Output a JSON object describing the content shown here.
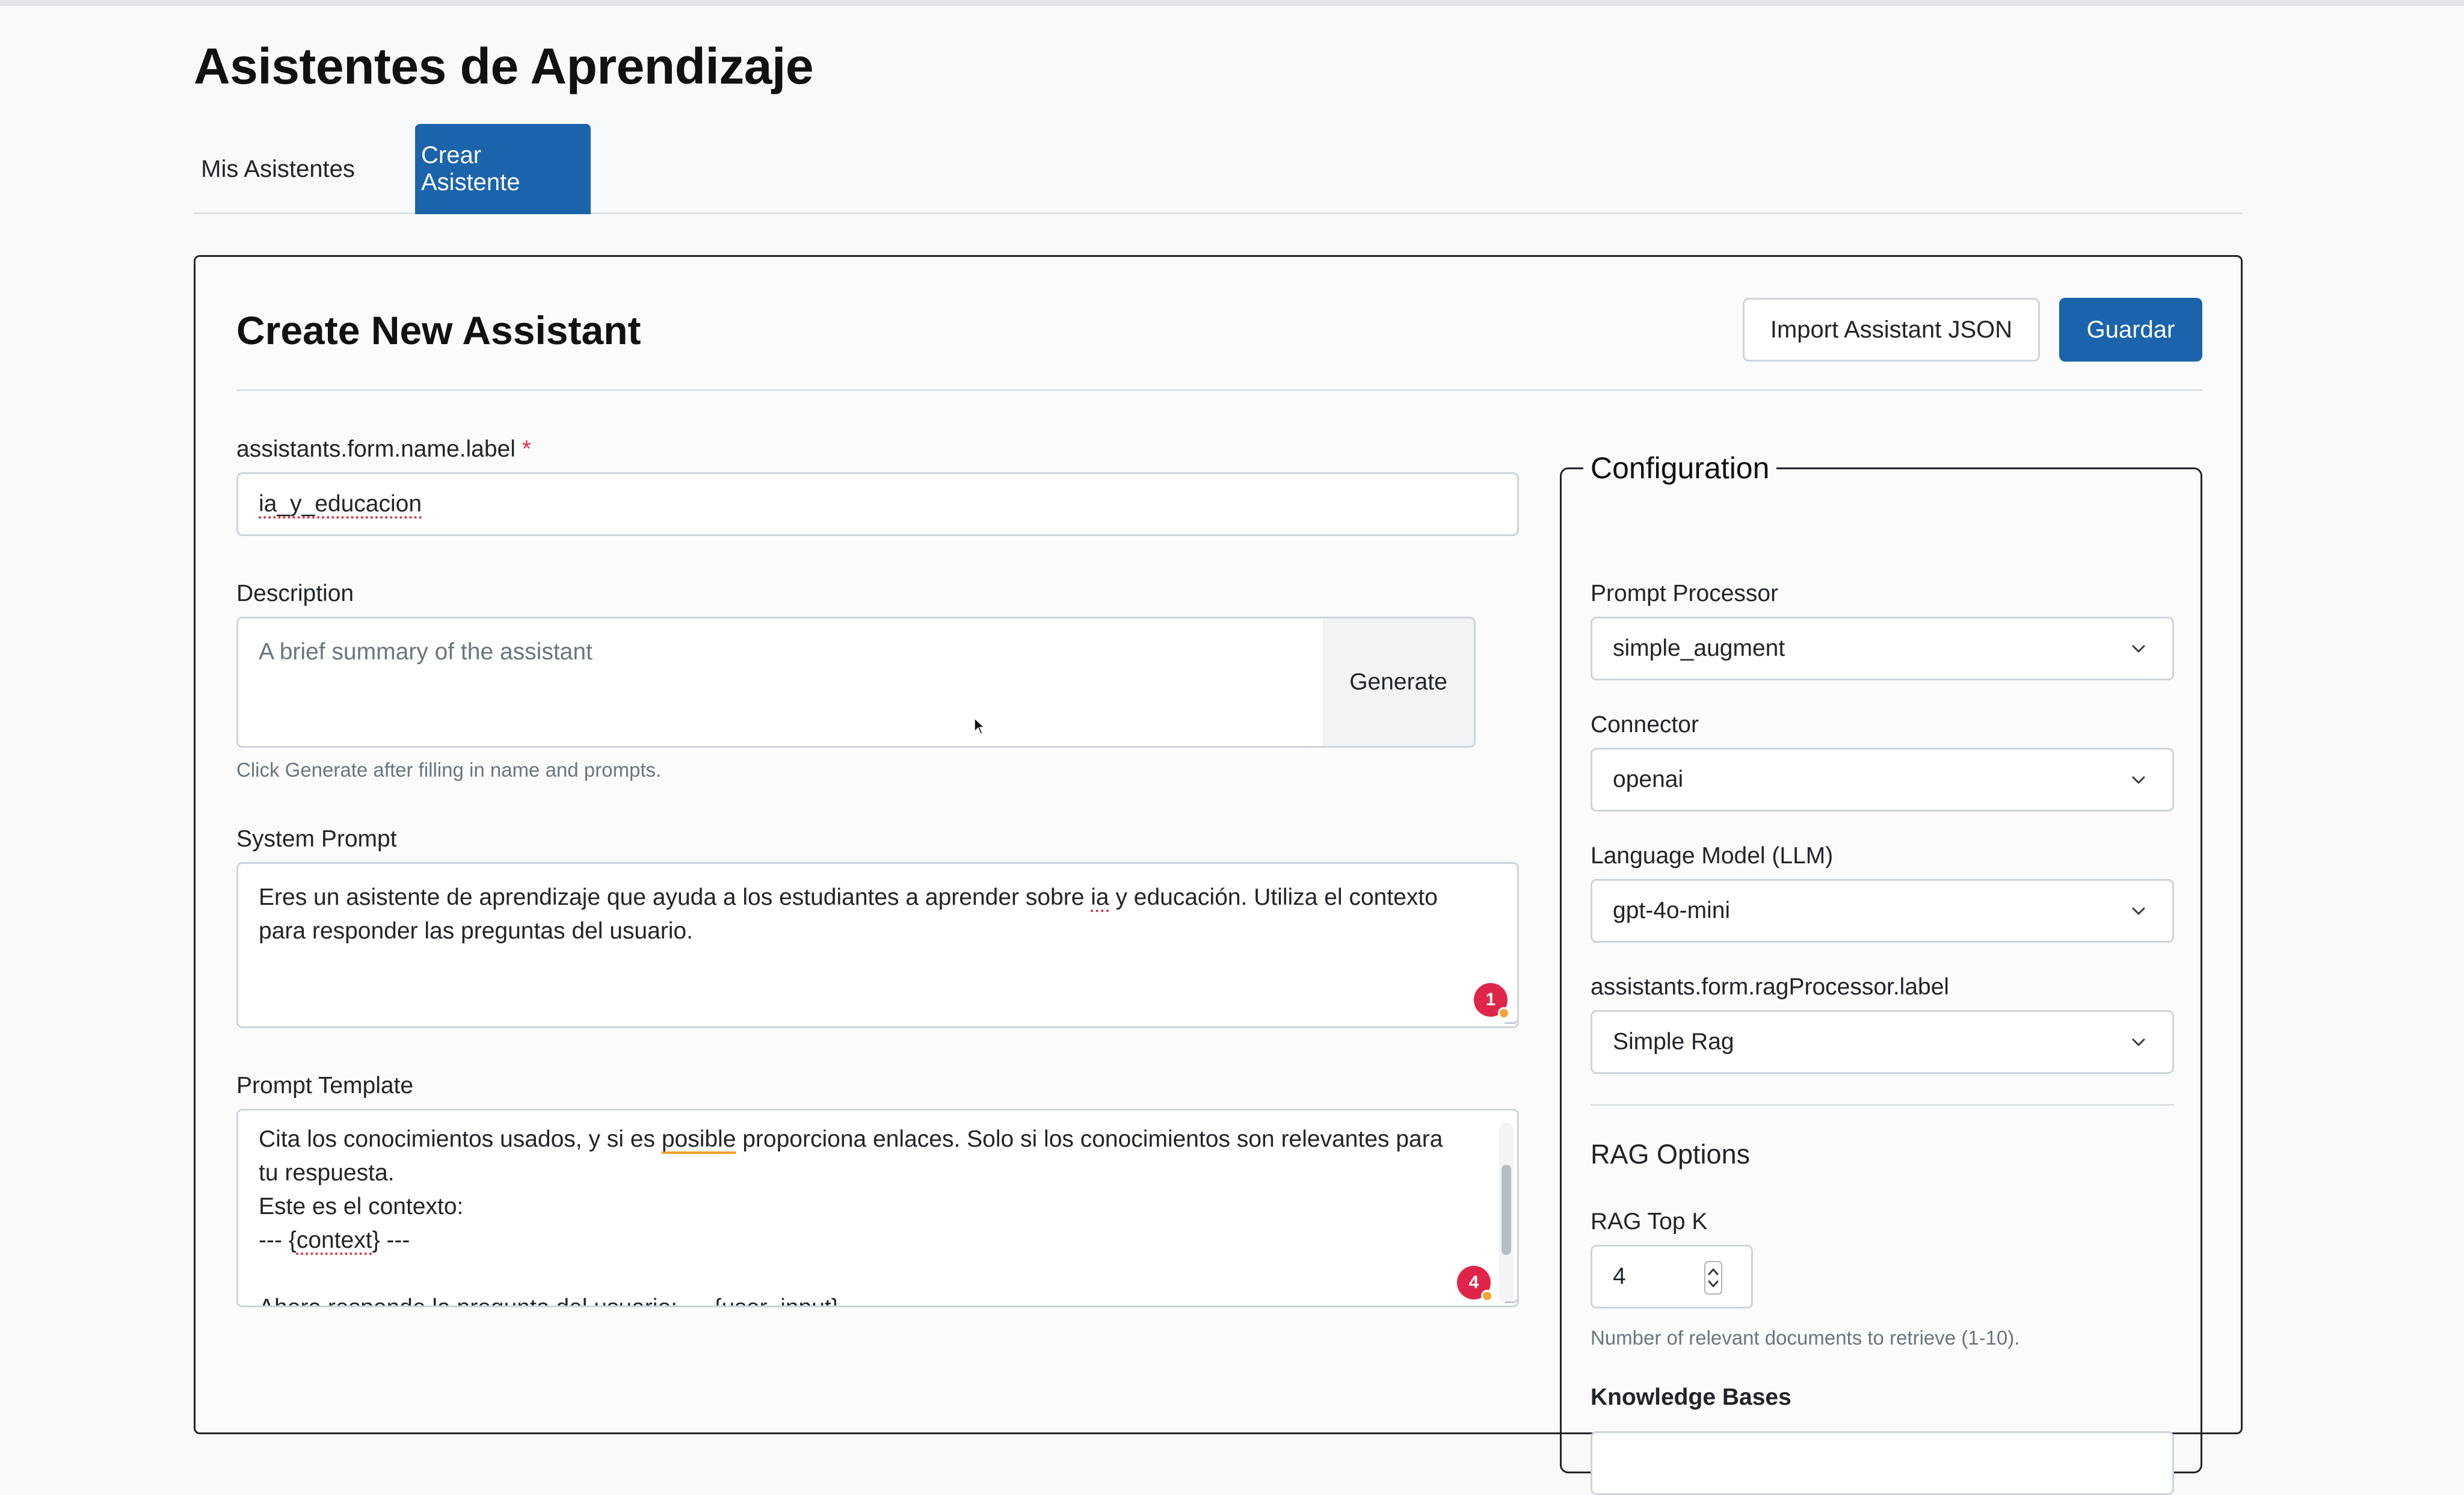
{
  "page": {
    "title": "Asistentes de Aprendizaje"
  },
  "tabs": [
    {
      "label": "Mis Asistentes",
      "active": false
    },
    {
      "label": "Crear Asistente",
      "active": true
    }
  ],
  "card": {
    "title": "Create New Assistant",
    "import_label": "Import Assistant JSON",
    "save_label": "Guardar"
  },
  "form": {
    "name": {
      "label": "assistants.form.name.label",
      "required_mark": "*",
      "value": "ia_y_educacion"
    },
    "description": {
      "label": "Description",
      "placeholder": "A brief summary of the assistant",
      "generate_label": "Generate",
      "hint": "Click Generate after filling in name and prompts."
    },
    "system_prompt": {
      "label": "System Prompt",
      "value_before": "Eres un asistente de aprendizaje que ayuda a los estudiantes a aprender sobre ",
      "value_flag": "ia",
      "value_after": " y educación. Utiliza el contexto para responder las preguntas del usuario.",
      "badge_count": "1"
    },
    "prompt_template": {
      "label": "Prompt Template",
      "line1_before": "Cita los conocimientos usados, y si es ",
      "line1_flag": "posible",
      "line1_after": " proporciona enlaces. Solo si los conocimientos son relevantes para tu respuesta.",
      "line2": "Este es el contexto:",
      "line3_before": " --- {",
      "line3_flag": "context",
      "line3_after": "} ---",
      "line4": "Ahora responde la pregunta del usuario: --- {user_input}",
      "badge_count": "4"
    }
  },
  "config": {
    "legend": "Configuration",
    "prompt_processor": {
      "label": "Prompt Processor",
      "value": "simple_augment"
    },
    "connector": {
      "label": "Connector",
      "value": "openai"
    },
    "llm": {
      "label": "Language Model (LLM)",
      "value": "gpt-4o-mini"
    },
    "rag_processor": {
      "label": "assistants.form.ragProcessor.label",
      "value": "Simple Rag"
    },
    "rag_options": {
      "title": "RAG Options",
      "top_k": {
        "label": "RAG Top K",
        "value": "4",
        "hint": "Number of relevant documents to retrieve (1-10)."
      },
      "knowledge_bases": {
        "label": "Knowledge Bases"
      }
    }
  },
  "colors": {
    "primary": "#1b64ac",
    "badge": "#e0254a",
    "required": "#dc3545"
  },
  "icons": {
    "select_chevron": "chevron-down-icon",
    "spinner": "spinner-arrows-icon",
    "mouse": "mouse-pointer-icon"
  }
}
